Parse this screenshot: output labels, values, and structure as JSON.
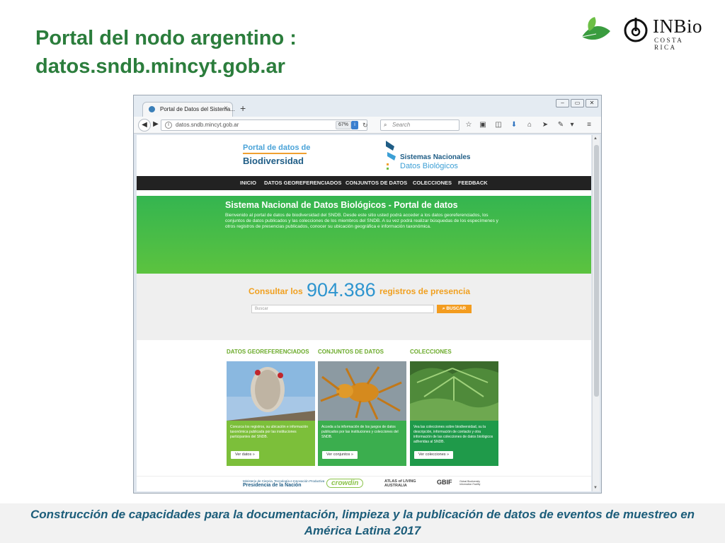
{
  "slide": {
    "title_line1": "Portal del nodo argentino :",
    "title_line2": "datos.sndb.mincyt.gob.ar",
    "footer_line1": "Construcción de capacidades para la documentación, limpieza y la publicación de datos de eventos de muestreo en",
    "footer_line2": "América Latina 2017"
  },
  "brand": {
    "inbio_name": "INBio",
    "inbio_sub": "COSTA RICA"
  },
  "browser": {
    "tab_title": "Portal de Datos del Sistema...",
    "tab_close": "×",
    "new_tab": "+",
    "url": "datos.sndb.mincyt.gob.ar",
    "zoom": "67%",
    "search_placeholder": "Search",
    "window_buttons": [
      "▭",
      "▭",
      "✕"
    ]
  },
  "site": {
    "portal_line1": "Portal de datos de",
    "portal_line2": "Biodiversidad",
    "sndb_line1": "Sistemas Nacionales",
    "sndb_line2": "Datos Biológicos",
    "menu": [
      "INICIO",
      "DATOS GEOREFERENCIADOS",
      "CONJUNTOS DE DATOS",
      "COLECCIONES",
      "FEEDBACK"
    ],
    "hero_title": "Sistema Nacional de Datos Biológicos - Portal de datos",
    "hero_text": "Bienvenido al portal de datos de biodiversidad del SNDB. Desde este sitio usted podrá acceder a los datos georeferenciados, los conjuntos de datos publicados y las colecciones de los miembros del SNDB. A su vez podrá realizar búsquedas de los especímenes y otros registros de presencias publicados, conocer su ubicación geográfica e información taxonómica.",
    "consult_prefix": "Consultar los",
    "records_count": "904.386",
    "consult_suffix": "registros de presencia",
    "search_placeholder": "Buscar",
    "search_button": "BUSCAR",
    "sections": [
      {
        "heading": "DATOS GEOREFERENCIADOS",
        "text": "Conozca los registros, su ubicación e información taxonómica publicada por las instituciones participantes del SNDB.",
        "button": "Ver datos »",
        "color": "#7cbf3a"
      },
      {
        "heading": "CONJUNTOS DE DATOS",
        "text": "Acceda a la información de los juegos de datos publicados por las instituciones y colecciones del SNDB.",
        "button": "Ver conjuntos »",
        "color": "#3bae4e"
      },
      {
        "heading": "COLECCIONES",
        "text": "Vea las colecciones sobre biodiversidad, su la descripción, información de contacto y otra información de las colecciones de datos biológicos adheridas al SNDB.",
        "button": "Ver colecciones »",
        "color": "#1f9a4a"
      }
    ],
    "footer_logos": [
      "Ministerio de Ciencia, Tecnología e Innovación Productiva",
      "Presidencia de la Nación",
      "crowdin",
      "ATLAS of LIVING AUSTRALIA",
      "GBIF",
      "Global Biodiversity Information Facility"
    ]
  }
}
